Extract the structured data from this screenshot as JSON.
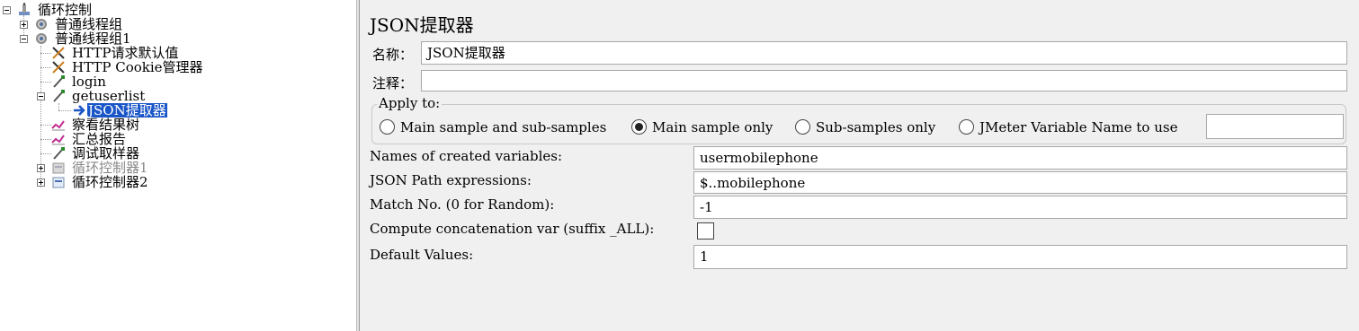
{
  "tree": {
    "nodes": [
      {
        "label": "循环控制",
        "state": "expanded",
        "icon": "test-plan-icon"
      },
      {
        "label": "普通线程组",
        "state": "collapsed",
        "icon": "thread-group-gear-icon"
      },
      {
        "label": "普通线程组1",
        "state": "expanded",
        "icon": "thread-group-gear-icon"
      },
      {
        "label": "HTTP请求默认值",
        "icon": "config-element-icon"
      },
      {
        "label": "HTTP Cookie管理器",
        "icon": "config-element-icon"
      },
      {
        "label": "login",
        "icon": "sampler-pipette-icon"
      },
      {
        "label": "getuserlist",
        "state": "expanded",
        "icon": "sampler-pipette-icon"
      },
      {
        "label": "JSON提取器",
        "icon": "post-processor-arrow-icon",
        "selected": true
      },
      {
        "label": "察看结果树",
        "icon": "listener-chart-icon"
      },
      {
        "label": "汇总报告",
        "icon": "listener-chart-icon"
      },
      {
        "label": "调试取样器",
        "icon": "sampler-pipette-icon"
      },
      {
        "label": "循环控制器1",
        "state": "collapsed",
        "icon": "controller-icon",
        "disabled": true
      },
      {
        "label": "循环控制器2",
        "state": "collapsed",
        "icon": "controller-icon"
      }
    ]
  },
  "panel": {
    "title": "JSON提取器",
    "name_label": "名称：",
    "name_value": "JSON提取器",
    "comment_label": "注释：",
    "comment_value": "",
    "apply_to": {
      "title": "Apply to:",
      "options": [
        "Main sample and sub-samples",
        "Main sample only",
        "Sub-samples only",
        "JMeter Variable Name to use"
      ],
      "selected": "Main sample only",
      "variable_value": ""
    },
    "fields": {
      "names_label": "Names of created variables:",
      "names_value": "usermobilephone",
      "paths_label": "JSON Path expressions:",
      "paths_value": "$..mobilephone",
      "match_label": "Match No. (0 for Random):",
      "match_value": "-1",
      "concat_label": "Compute concatenation var (suffix _ALL):",
      "concat_checked": false,
      "default_label": "Default Values:",
      "default_value": "1"
    }
  },
  "colors": {
    "selection": "#1a56c8",
    "panel_bg": "#f0f0f0"
  }
}
